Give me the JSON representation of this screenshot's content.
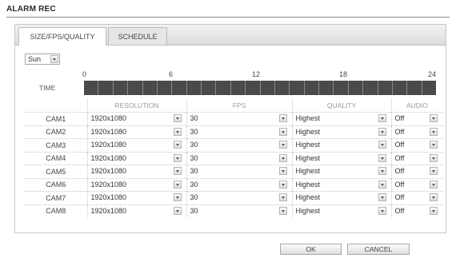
{
  "page": {
    "title": "ALARM REC"
  },
  "tabs": [
    {
      "label": "SIZE/FPS/QUALITY",
      "active": true
    },
    {
      "label": "SCHEDULE",
      "active": false
    }
  ],
  "day_select": {
    "value": "Sun"
  },
  "timeline": {
    "label": "TIME",
    "ticks": [
      "0",
      "6",
      "12",
      "18",
      "24"
    ],
    "segments": 24
  },
  "table": {
    "headers": [
      "",
      "RESOLUTION",
      "FPS",
      "QUALITY",
      "AUDIO"
    ],
    "rows": [
      {
        "cam": "CAM1",
        "resolution": "1920x1080",
        "fps": "30",
        "quality": "Highest",
        "audio": "Off"
      },
      {
        "cam": "CAM2",
        "resolution": "1920x1080",
        "fps": "30",
        "quality": "Highest",
        "audio": "Off"
      },
      {
        "cam": "CAM3",
        "resolution": "1920x1080",
        "fps": "30",
        "quality": "Highest",
        "audio": "Off"
      },
      {
        "cam": "CAM4",
        "resolution": "1920x1080",
        "fps": "30",
        "quality": "Highest",
        "audio": "Off"
      },
      {
        "cam": "CAM5",
        "resolution": "1920x1080",
        "fps": "30",
        "quality": "Highest",
        "audio": "Off"
      },
      {
        "cam": "CAM6",
        "resolution": "1920x1080",
        "fps": "30",
        "quality": "Highest",
        "audio": "Off"
      },
      {
        "cam": "CAM7",
        "resolution": "1920x1080",
        "fps": "30",
        "quality": "Highest",
        "audio": "Off"
      },
      {
        "cam": "CAM8",
        "resolution": "1920x1080",
        "fps": "30",
        "quality": "Highest",
        "audio": "Off"
      }
    ]
  },
  "buttons": {
    "ok": "OK",
    "cancel": "CANCEL"
  }
}
